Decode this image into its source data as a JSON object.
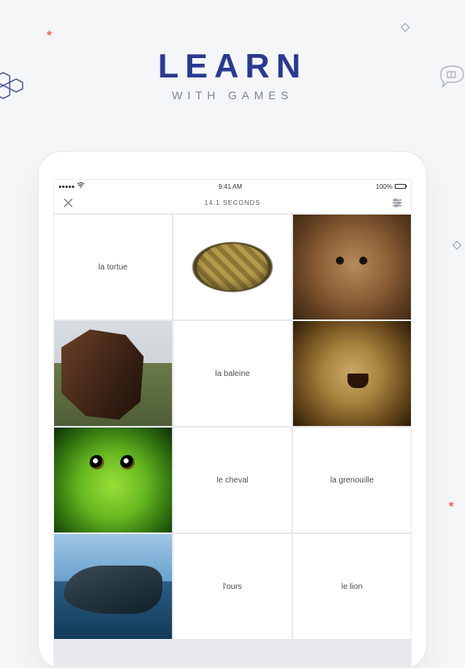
{
  "promo": {
    "title": "LEARN",
    "subtitle": "WITH GAMES"
  },
  "status": {
    "time": "9:41 AM",
    "battery_pct": "100%"
  },
  "nav": {
    "timer_label": "14.1 SECONDS"
  },
  "cards": {
    "r1c1": "la tortue",
    "r2c2": "la baleine",
    "r3c2": "le cheval",
    "r3c3": "la grenouille",
    "r4c2": "l'ours",
    "r4c3": "le lion"
  }
}
